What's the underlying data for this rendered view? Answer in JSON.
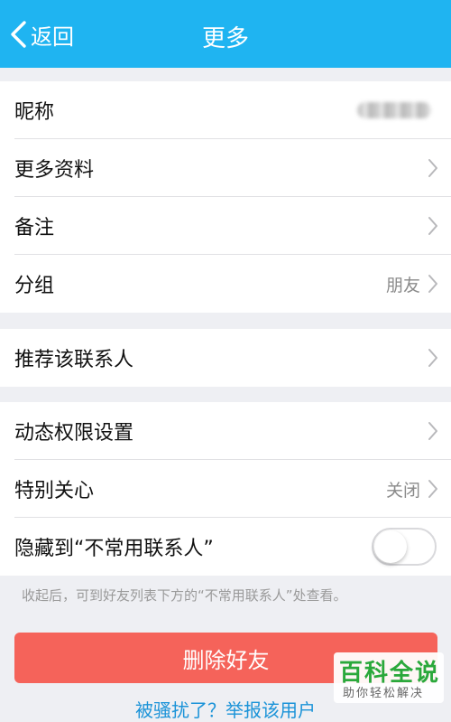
{
  "nav": {
    "back_label": "返回",
    "title": "更多"
  },
  "group1": {
    "nickname_label": "昵称",
    "more_info_label": "更多资料",
    "remark_label": "备注",
    "group_label": "分组",
    "group_value": "朋友"
  },
  "group2": {
    "recommend_label": "推荐该联系人"
  },
  "group3": {
    "permission_label": "动态权限设置",
    "special_care_label": "特别关心",
    "special_care_value": "关闭",
    "hide_label": "隐藏到“不常用联系人”",
    "hide_enabled": false
  },
  "hint_text": "收起后，可到好友列表下方的“不常用联系人”处查看。",
  "delete_button": "删除好友",
  "report_link": "被骚扰了？举报该用户",
  "watermark": {
    "main": "百科全说",
    "sub": "助你轻松解决"
  },
  "colors": {
    "nav": "#1fb4f1",
    "danger": "#f5635a",
    "link": "#1b93d8"
  }
}
